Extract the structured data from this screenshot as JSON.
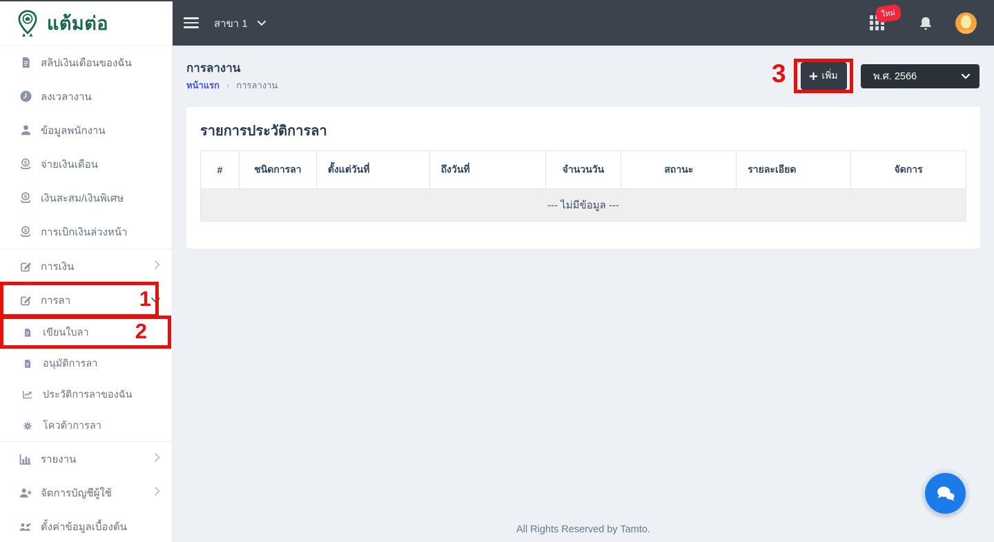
{
  "brand": {
    "name": "แต้มต่อ"
  },
  "topbar": {
    "branch_label": "สาขา 1",
    "new_badge": "ใหม่"
  },
  "sidebar": {
    "items": [
      {
        "label": "สลิปเงินเดือนของฉัน",
        "icon": "payslip-file-icon"
      },
      {
        "label": "ลงเวลางาน",
        "icon": "clock-icon"
      },
      {
        "label": "ข้อมูลพนักงาน",
        "icon": "employee-user-icon"
      },
      {
        "label": "จ่ายเงินเดือน",
        "icon": "money-icon"
      },
      {
        "label": "เงินสะสม/เงินพิเศษ",
        "icon": "money-icon"
      },
      {
        "label": "การเบิกเงินล่วงหน้า",
        "icon": "money-icon"
      },
      {
        "label": "การเงิน",
        "icon": "edit-square-icon",
        "chevron": "right",
        "divider_before": true
      },
      {
        "label": "การลา",
        "icon": "edit-square-icon",
        "chevron": "down"
      },
      {
        "label": "เขียนใบลา",
        "icon": "document-icon",
        "sub": true
      },
      {
        "label": "อนุมัติการลา",
        "icon": "document-icon",
        "sub": true
      },
      {
        "label": "ประวัติการลาของฉัน",
        "icon": "history-chart-icon",
        "sub": true
      },
      {
        "label": "โควต้าการลา",
        "icon": "gear-icon",
        "sub": true
      },
      {
        "label": "รายงาน",
        "icon": "bar-chart-icon",
        "chevron": "right",
        "divider_before": true
      },
      {
        "label": "จัดการบัญชีผู้ใช้",
        "icon": "user-plus-icon",
        "chevron": "right"
      },
      {
        "label": "ตั้งค่าข้อมูลเบื้องต้น",
        "icon": "users-gear-icon",
        "clipped": true
      }
    ]
  },
  "page": {
    "title": "การลางาน",
    "breadcrumb": {
      "home": "หน้าแรก",
      "current": "การลางาน"
    },
    "add_button_label": "เพิ่ม",
    "year_select_value": "พ.ศ. 2566"
  },
  "leave_table": {
    "section_title": "รายการประวัติการลา",
    "headers": [
      "#",
      "ชนิดการลา",
      "ตั้งแต่วันที่",
      "ถึงวันที่",
      "จำนวนวัน",
      "สถานะ",
      "รายละเอียด",
      "จัดการ"
    ],
    "empty_text": "--- ไม่มีข้อมูล ---"
  },
  "annotations": {
    "step1": "1",
    "step2": "2",
    "step3": "3"
  },
  "footer": {
    "copyright": "All Rights Reserved by Tamto."
  },
  "colors": {
    "topbar": "#3d434d",
    "brand_green": "#17684a",
    "annotation_red": "#e8100c",
    "badge_red": "#f0283c",
    "chat_blue": "#1a7be9",
    "avatar_orange": "#f2a33c",
    "breadcrumb_link": "#4650e5"
  }
}
